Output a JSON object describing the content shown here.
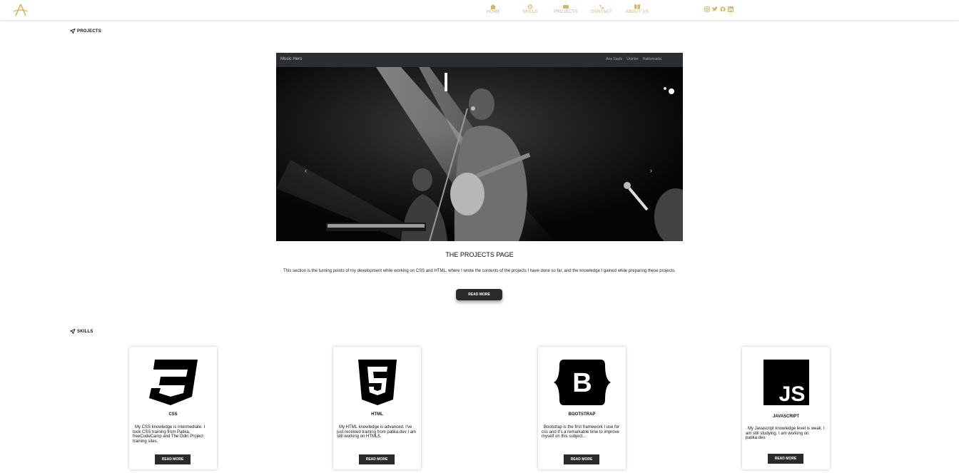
{
  "nav": {
    "items": [
      {
        "label": "HOME",
        "icon": "home-icon"
      },
      {
        "label": "SKILLS",
        "icon": "gear-icon"
      },
      {
        "label": "PROJECTS",
        "icon": "card-icon"
      },
      {
        "label": "CONTACT",
        "icon": "phone-icon"
      },
      {
        "label": "ABOUT US",
        "icon": "book-icon"
      }
    ],
    "socials": [
      "instagram-icon",
      "twitter-icon",
      "github-icon",
      "linkedin-icon"
    ],
    "accent": "#d9b36a"
  },
  "projects": {
    "label": "PROJECTS",
    "hero": {
      "brand": "Music Hero",
      "links": [
        "Ana Sayfa",
        "Ürünler",
        "Hakkımızda"
      ]
    },
    "title": "THE PROJECTS PAGE",
    "description": "This section is the turning points of my development while working on CSS and HTML, where I wrote the contents of the projects I have done so far, and the knowledge I gained while preparing these projects.",
    "button": "READ MORE"
  },
  "skills": {
    "label": "SKILLS",
    "cards": [
      {
        "title": "CSS",
        "text": "My CSS knowledge is intermediate. I took CSS training from Patika, freeCodeCamp and The Odin Project training sites.",
        "button": "READ MORE"
      },
      {
        "title": "HTML",
        "text": "My HTML knowledge is advanced. I've just received training from patika.dev I am still working on HTML5.",
        "button": "READ MORE"
      },
      {
        "title": "BOOTSTRAP",
        "text": "Bootstrap is the first framework I use for css and it's a remarkable time to improve myself on this subject...",
        "button": "READ MORE"
      },
      {
        "title": "JAVASCRIPT",
        "text": "My Javascript knowledge level is weak. I am still studying. I am working on patika.dev.",
        "button": "READ MORE"
      }
    ]
  }
}
